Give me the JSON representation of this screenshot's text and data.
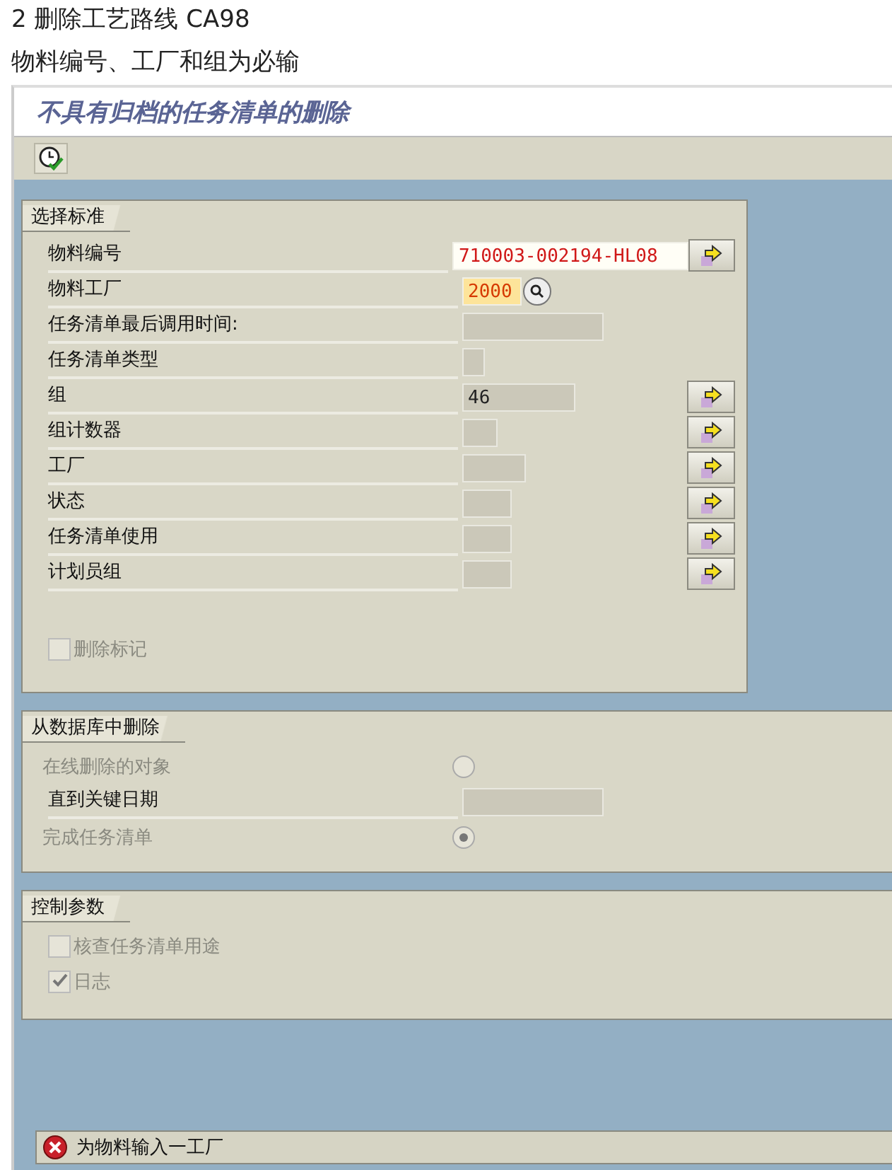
{
  "article": {
    "heading": "2 删除工艺路线 CA98",
    "note": "物料编号、工厂和组为必输"
  },
  "window": {
    "title": "不具有归档的任务清单的删除"
  },
  "toolbar": {
    "buttons": [
      {
        "kind": "execute"
      }
    ]
  },
  "sections": [
    {
      "title": "选择标准",
      "rows": [
        {
          "kind": "field",
          "label": "物料编号",
          "value": "710003-002194-HL08",
          "editable": true,
          "error": false,
          "search_help": false,
          "multiple_selection": true
        },
        {
          "kind": "field",
          "label": "物料工厂",
          "value": "2000",
          "editable": true,
          "error": true,
          "search_help": true,
          "multiple_selection": false
        },
        {
          "kind": "field",
          "label": "任务清单最后调用时间:",
          "editable": false,
          "error": false,
          "search_help": false,
          "multiple_selection": false
        },
        {
          "kind": "field",
          "label": "任务清单类型",
          "editable": false,
          "error": false,
          "search_help": false,
          "multiple_selection": false
        },
        {
          "kind": "field",
          "label": "组",
          "value": "46",
          "editable": false,
          "error": false,
          "search_help": false,
          "multiple_selection": true
        },
        {
          "kind": "field",
          "label": "组计数器",
          "editable": false,
          "error": false,
          "search_help": false,
          "multiple_selection": true
        },
        {
          "kind": "field",
          "label": "工厂",
          "editable": false,
          "error": false,
          "search_help": false,
          "multiple_selection": true
        },
        {
          "kind": "field",
          "label": "状态",
          "editable": false,
          "error": false,
          "search_help": false,
          "multiple_selection": true
        },
        {
          "kind": "field",
          "label": "任务清单使用",
          "editable": false,
          "error": false,
          "search_help": false,
          "multiple_selection": true
        },
        {
          "kind": "field",
          "label": "计划员组",
          "editable": false,
          "error": false,
          "search_help": false,
          "multiple_selection": true
        },
        {
          "kind": "checkbox",
          "label": "删除标记",
          "checked": false,
          "disabled": true
        }
      ]
    },
    {
      "title": "从数据库中删除",
      "rows": [
        {
          "kind": "radio",
          "label": "在线删除的对象",
          "selected": false,
          "disabled": true
        },
        {
          "kind": "field",
          "label": "直到关键日期",
          "editable": false,
          "error": false,
          "search_help": false,
          "multiple_selection": false
        },
        {
          "kind": "radio",
          "label": "完成任务清单",
          "selected": true,
          "disabled": true
        }
      ]
    },
    {
      "title": "控制参数",
      "rows": [
        {
          "kind": "checkbox",
          "label": "核查任务清单用途",
          "checked": false,
          "disabled": true
        },
        {
          "kind": "checkbox",
          "label": "日志",
          "checked": true,
          "disabled": true
        }
      ]
    }
  ],
  "status_bar": {
    "kind": "error",
    "message": "为物料输入一工厂"
  }
}
